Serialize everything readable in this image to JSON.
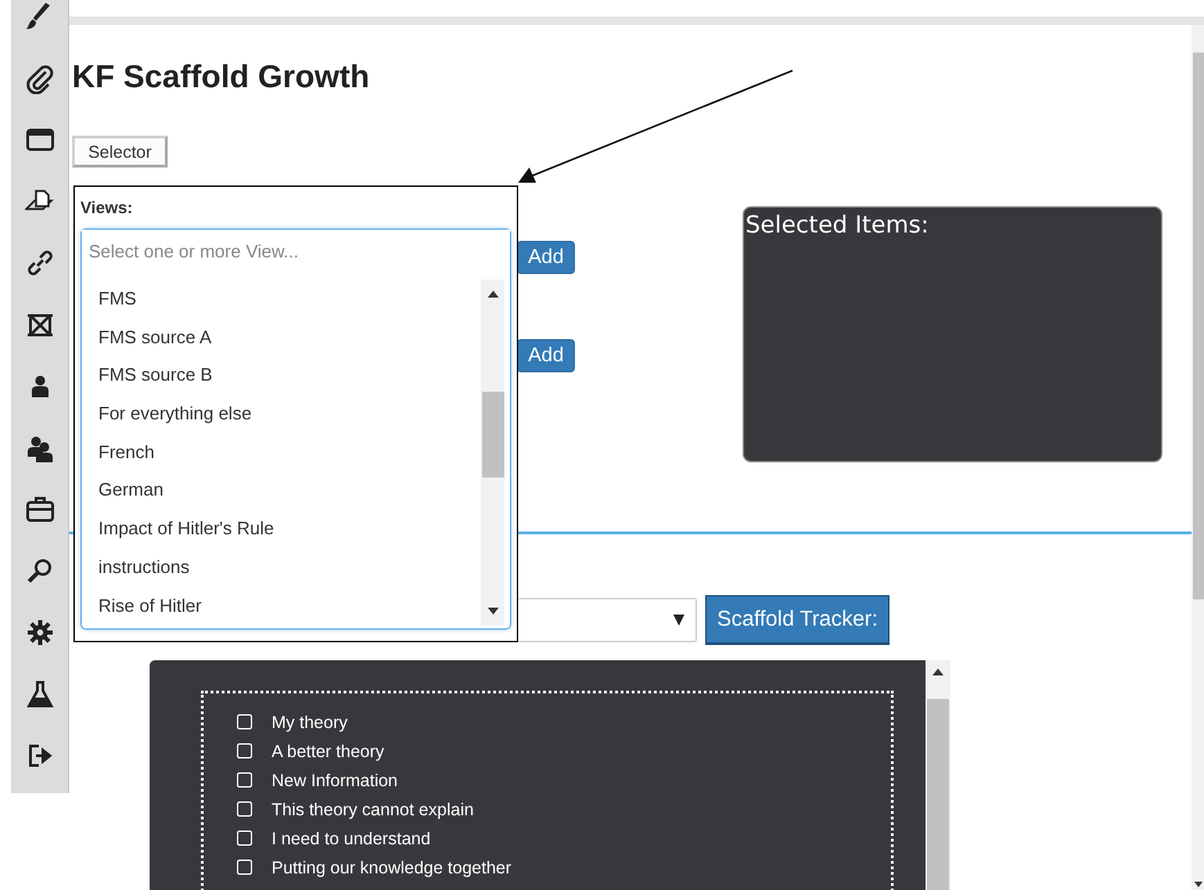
{
  "title": "KF Scaffold Growth",
  "selector_button": "Selector",
  "views_dropdown": {
    "label": "Views:",
    "placeholder": "Select one or more View...",
    "options": [
      {
        "label": "FMS"
      },
      {
        "label": "FMS source A"
      },
      {
        "label": "FMS source B"
      },
      {
        "label": "For everything else"
      },
      {
        "label": "French"
      },
      {
        "label": "German"
      },
      {
        "label": "Impact of Hitler's Rule"
      },
      {
        "label": "instructions"
      },
      {
        "label": "Rise of Hitler"
      }
    ]
  },
  "add_buttons": [
    "Add",
    "Add"
  ],
  "selected_items": {
    "title": "Selected Items:"
  },
  "scaffold_tracker_button": "Scaffold Tracker:",
  "scaffolds": [
    {
      "label": "My theory",
      "checked": false
    },
    {
      "label": "A better theory",
      "checked": false
    },
    {
      "label": "New Information",
      "checked": false
    },
    {
      "label": "This theory cannot explain",
      "checked": false
    },
    {
      "label": "I need to understand",
      "checked": false
    },
    {
      "label": "Putting our knowledge together",
      "checked": false
    }
  ]
}
